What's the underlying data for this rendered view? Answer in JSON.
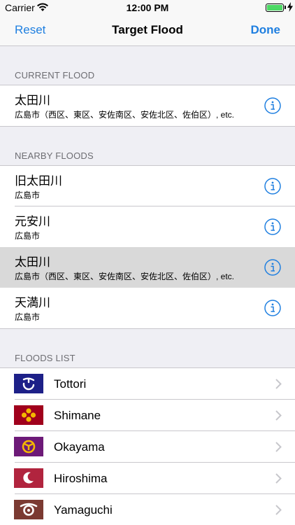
{
  "status_bar": {
    "carrier": "Carrier",
    "time": "12:00 PM"
  },
  "nav": {
    "left": "Reset",
    "title": "Target Flood",
    "right": "Done"
  },
  "current": {
    "header": "CURRENT FLOOD",
    "items": [
      {
        "name": "太田川",
        "sub": "広島市（西区、東区、安佐南区、安佐北区、佐伯区）, etc."
      }
    ]
  },
  "nearby": {
    "header": "NEARBY FLOODS",
    "items": [
      {
        "name": "旧太田川",
        "sub": "広島市"
      },
      {
        "name": "元安川",
        "sub": "広島市"
      },
      {
        "name": "太田川",
        "sub": "広島市（西区、東区、安佐南区、安佐北区、佐伯区）, etc."
      },
      {
        "name": "天満川",
        "sub": "広島市"
      }
    ]
  },
  "list": {
    "header": "FLOODS LIST",
    "items": [
      {
        "label": "Tottori",
        "flag_color": "#1d2088",
        "icon": "tottori-flag-icon"
      },
      {
        "label": "Shimane",
        "flag_color": "#a0001c",
        "icon": "shimane-flag-icon"
      },
      {
        "label": "Okayama",
        "flag_color": "#6d1a78",
        "icon": "okayama-flag-icon"
      },
      {
        "label": "Hiroshima",
        "flag_color": "#b1243e",
        "icon": "hiroshima-flag-icon"
      },
      {
        "label": "Yamaguchi",
        "flag_color": "#7b3a32",
        "icon": "yamaguchi-flag-icon"
      }
    ]
  },
  "colors": {
    "accent": "#1f7fe0",
    "background": "#efeff4",
    "selected_row": "#d9d9d9"
  }
}
